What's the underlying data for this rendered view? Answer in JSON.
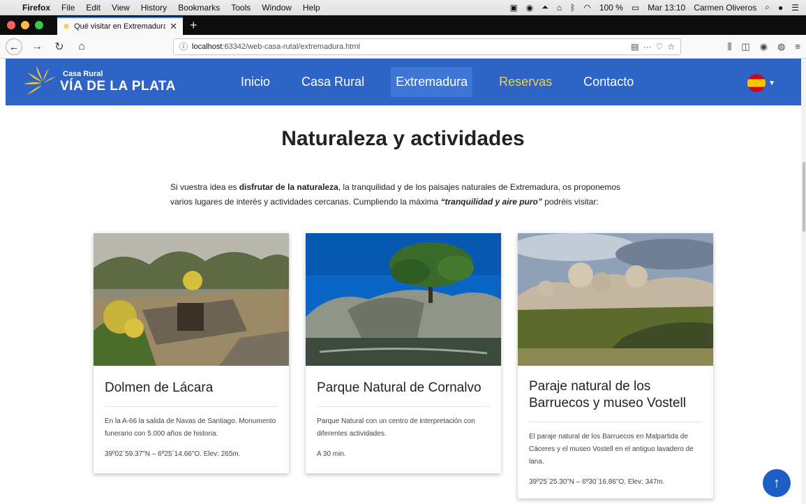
{
  "menubar": {
    "app": "Firefox",
    "items": [
      "File",
      "Edit",
      "View",
      "History",
      "Bookmarks",
      "Tools",
      "Window",
      "Help"
    ],
    "battery": "100 %",
    "clock": "Mar 13:10",
    "user": "Carmen Oliveros"
  },
  "tab": {
    "title": "Qué visitar en Extremadura - Ca"
  },
  "toolbar": {
    "url_host": "localhost",
    "url_path": ":63342/web-casa-rutal/extremadura.html"
  },
  "site": {
    "logo_small": "Casa Rural",
    "logo_big": "VÍA DE LA PLATA",
    "nav": [
      "Inicio",
      "Casa Rural",
      "Extremadura",
      "Reservas",
      "Contacto"
    ]
  },
  "main": {
    "title": "Naturaleza y actividades",
    "intro_1": "Si vuestra idea es ",
    "intro_bold": "disfrutar de la naturaleza",
    "intro_2": ", la tranquilidad y de los paisajes naturales de Extremadura, os proponemos varios lugares de interés y actividades cercanas. Cumpliendo la máxima ",
    "intro_italic": "“tranquilidad y aire puro”",
    "intro_3": " podréis visitar:"
  },
  "cards": [
    {
      "title": "Dolmen de Lácara",
      "text": "En la A-66 la salida de Navas de Santiago. Monumento funerario con 5.000 años de historia.",
      "meta": "39º02´59.37\"N – 6º25´14.66\"O. Elev: 265m."
    },
    {
      "title": "Parque Natural de Cornalvo",
      "text": "Parque Natural con un centro de interpretación con diferentes actividades.",
      "meta": "A 30 min."
    },
    {
      "title": "Paraje natural de los Barruecos y museo Vostell",
      "text": "El paraje natural de los Barruecos en Malpartida de Cáceres y el museo Vostell en el antiguo lavadero de lana.",
      "meta": "39º25´25.30\"N – 6º30´16.86\"O. Elev: 347m."
    }
  ],
  "colors": {
    "nav_bg": "#2d64c6",
    "nav_active": "#3f76d6",
    "highlight": "#f4d23c",
    "totop": "#1d5ec4"
  }
}
